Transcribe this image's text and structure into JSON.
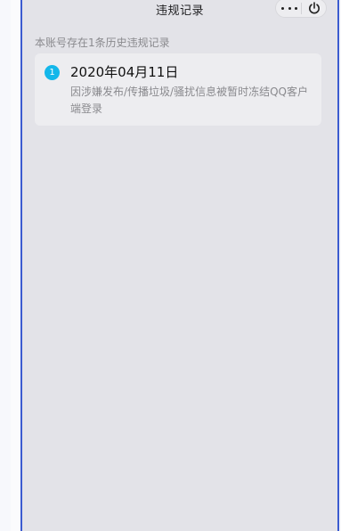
{
  "header": {
    "title": "违规记录",
    "more_icon": "more-horizontal-icon",
    "power_icon": "power-icon"
  },
  "summary": "本账号存在1条历史违规记录",
  "records": [
    {
      "index": "1",
      "date": "2020年04月11日",
      "description": "因涉嫌发布/传播垃圾/骚扰信息被暂时冻结QQ客户端登录"
    }
  ],
  "colors": {
    "accent": "#14b7ea",
    "frame": "#3c5bd0",
    "background": "#e3e3e8"
  }
}
